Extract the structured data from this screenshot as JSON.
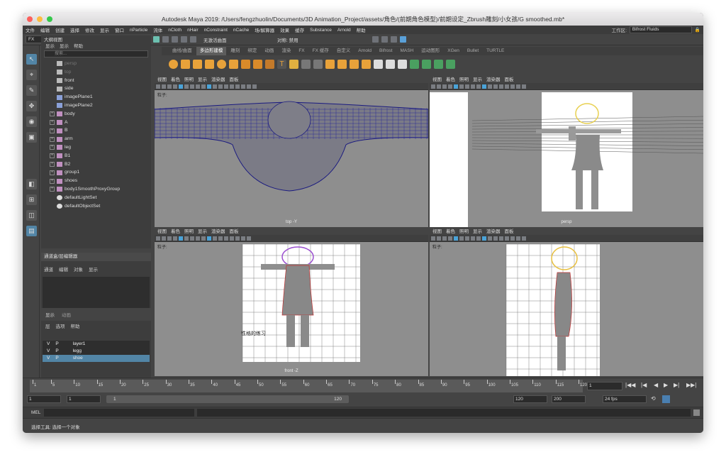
{
  "window": {
    "title": "Autodesk Maya 2019: /Users/fengzhuolin/Documents/3D Animation_Project/assets/角色/(前期角色模型)/前期设定_Zbrush雕刻/小女孩/G smoothed.mb*"
  },
  "menubar": {
    "items": [
      "文件",
      "编辑",
      "创建",
      "选择",
      "修改",
      "显示",
      "窗口",
      "nParticle",
      "流体",
      "nCloth",
      "nHair",
      "nConstraint",
      "nCache",
      "场/解算器",
      "效果",
      "缓存",
      "Substance",
      "Arnold",
      "帮助"
    ],
    "workspace_label": "工作区:",
    "workspace_value": "Bifrost Fluids"
  },
  "toolbar": {
    "mode": "FX",
    "live_surface": "无激活曲面",
    "symmetry": "对称: 禁用"
  },
  "shelf": {
    "tabs": [
      "曲线/曲面",
      "多边形建模",
      "雕刻",
      "绑定",
      "动画",
      "渲染",
      "FX",
      "FX 缓存",
      "自定义",
      "Arnold",
      "Bifrost",
      "MASH",
      "运动图形",
      "XGen",
      "Bullet",
      "TURTLE"
    ],
    "active_tab": "多边形建模"
  },
  "outliner": {
    "title": "大纲视图",
    "menu": [
      "显示",
      "显示",
      "帮助"
    ],
    "search_placeholder": "搜索...",
    "items": [
      {
        "label": "persp",
        "type": "camera",
        "dim": true
      },
      {
        "label": "top",
        "type": "camera",
        "dim": true
      },
      {
        "label": "front",
        "type": "camera",
        "dim": false
      },
      {
        "label": "side",
        "type": "camera",
        "dim": false
      },
      {
        "label": "imagePlane1",
        "type": "image",
        "dim": false
      },
      {
        "label": "imagePlane2",
        "type": "image",
        "dim": false
      },
      {
        "label": "body",
        "type": "group",
        "dim": false
      },
      {
        "label": "A",
        "type": "group",
        "dim": false
      },
      {
        "label": "B",
        "type": "group",
        "dim": false
      },
      {
        "label": "arm",
        "type": "group",
        "dim": false
      },
      {
        "label": "leg",
        "type": "group",
        "dim": false
      },
      {
        "label": "B1",
        "type": "group",
        "dim": false
      },
      {
        "label": "B2",
        "type": "group",
        "dim": false
      },
      {
        "label": "group1",
        "type": "group",
        "dim": false
      },
      {
        "label": "shoes",
        "type": "group",
        "dim": false
      },
      {
        "label": "body1SmoothProxyGroup",
        "type": "group",
        "dim": false
      },
      {
        "label": "defaultLightSet",
        "type": "set",
        "dim": false
      },
      {
        "label": "defaultObjectSet",
        "type": "set",
        "dim": false
      }
    ]
  },
  "channelbox": {
    "title": "通道盒/层编辑器",
    "menu": [
      "通道",
      "编辑",
      "对象",
      "显示"
    ],
    "layer_tabs": [
      "显示",
      "动画"
    ],
    "layer_menu": [
      "层",
      "选项",
      "帮助"
    ],
    "layers": [
      {
        "v": "V",
        "p": "P",
        "name": "layer1",
        "selected": false
      },
      {
        "v": "V",
        "p": "P",
        "name": "legg",
        "selected": false
      },
      {
        "v": "V",
        "p": "P",
        "name": "shoe",
        "selected": true
      }
    ]
  },
  "viewport_menu": [
    "视图",
    "着色",
    "照明",
    "显示",
    "渲染器",
    "面板"
  ],
  "viewports": [
    {
      "label": "top -Y",
      "particle": "粒子:",
      "nums": "0",
      "exposure": "0.0"
    },
    {
      "label": "persp",
      "particle": "",
      "nums": "",
      "exposure": "0.0"
    },
    {
      "label": "front -Z",
      "particle": "粒子:",
      "nums": "0",
      "exposure": "0.0"
    },
    {
      "label": "",
      "particle": "粒子:",
      "nums": "0",
      "exposure": "0.0"
    }
  ],
  "front_caption": "性格的练习",
  "persp_caption": "性格的练习",
  "timeline": {
    "ticks": [
      "1",
      "5",
      "10",
      "15",
      "20",
      "25",
      "30",
      "35",
      "40",
      "45",
      "50",
      "55",
      "60",
      "65",
      "70",
      "75",
      "80",
      "85",
      "90",
      "95",
      "100",
      "105",
      "110",
      "115",
      "120"
    ],
    "current": "1"
  },
  "range": {
    "start": "1",
    "start2": "1",
    "slider_start": "1",
    "slider_end": "120",
    "end": "120",
    "end2": "200",
    "fps": "24 fps"
  },
  "mel": {
    "label": "MEL"
  },
  "help": {
    "text": "选择工具: 选择一个对象"
  },
  "colors": {
    "accent": "#5aa0d8",
    "selected_layer": "#5285a6",
    "maya_logo": "#21c0dc"
  }
}
